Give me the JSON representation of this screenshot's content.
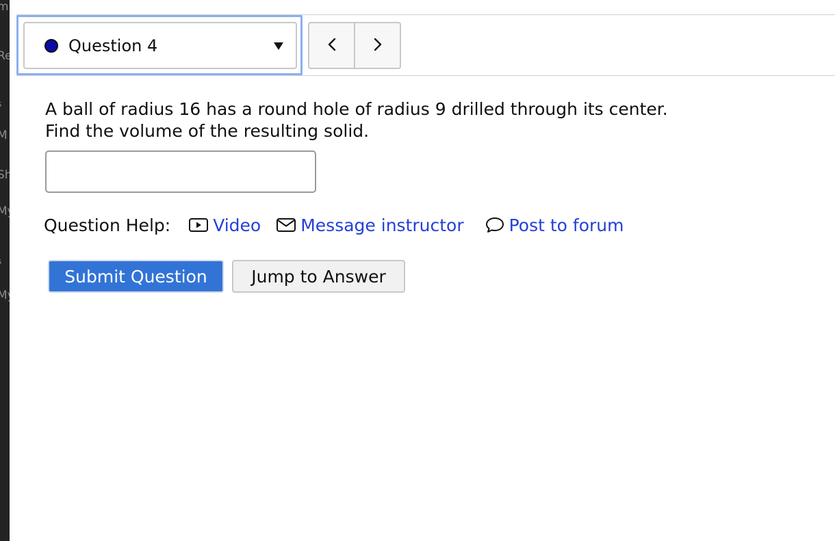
{
  "left_sidebar": {
    "fragments": [
      "m",
      "Re",
      "s",
      "M",
      "Sh",
      "My",
      "s",
      "My"
    ]
  },
  "question_nav": {
    "selected_question": "Question 4",
    "status_color": "#0b0ba8",
    "prev_icon": "chevron-left-icon",
    "next_icon": "chevron-right-icon",
    "dropdown_icon": "caret-down-icon"
  },
  "question": {
    "line1": "A ball of radius 16 has a round hole of radius 9 drilled through its center.",
    "line2": "Find the volume of the resulting solid.",
    "answer_value": ""
  },
  "help": {
    "label": "Question Help:",
    "video_label": "Video",
    "message_label": "Message instructor",
    "forum_label": "Post to forum",
    "link_color": "#2440d8"
  },
  "actions": {
    "submit_label": "Submit Question",
    "jump_label": "Jump to Answer",
    "submit_color": "#3274d6"
  }
}
